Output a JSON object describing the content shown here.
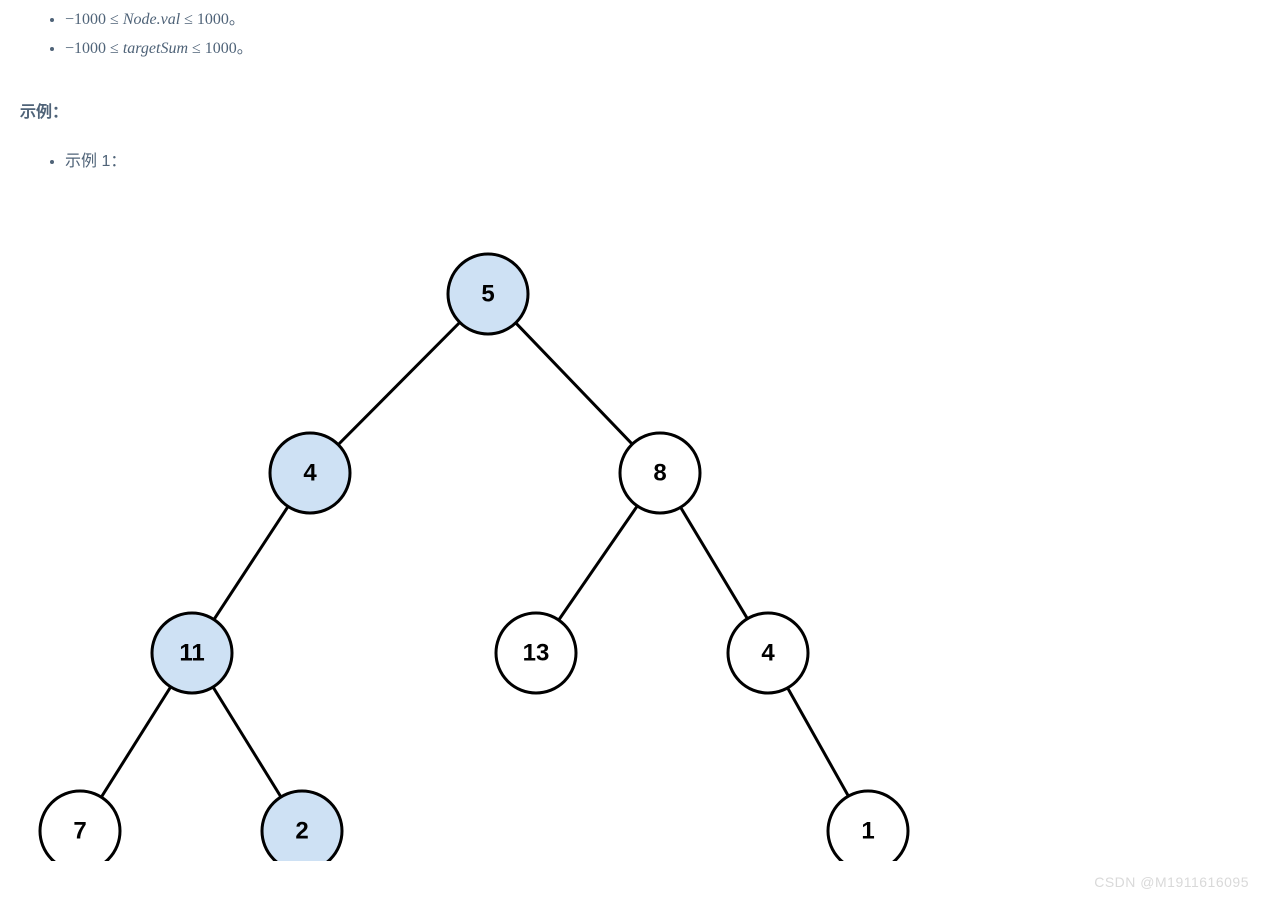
{
  "constraints": {
    "c1": "−1000 ≤ Node.val ≤ 1000。",
    "c2": "−1000 ≤ targetSum ≤ 1000。"
  },
  "headings": {
    "example_section": "示例：",
    "example_1": "示例 1："
  },
  "tree": {
    "nodes": {
      "n5": "5",
      "n4a": "4",
      "n8": "8",
      "n11": "11",
      "n13": "13",
      "n4b": "4",
      "n7": "7",
      "n2": "2",
      "n1": "1"
    }
  },
  "watermark": "CSDN @M1911616095"
}
